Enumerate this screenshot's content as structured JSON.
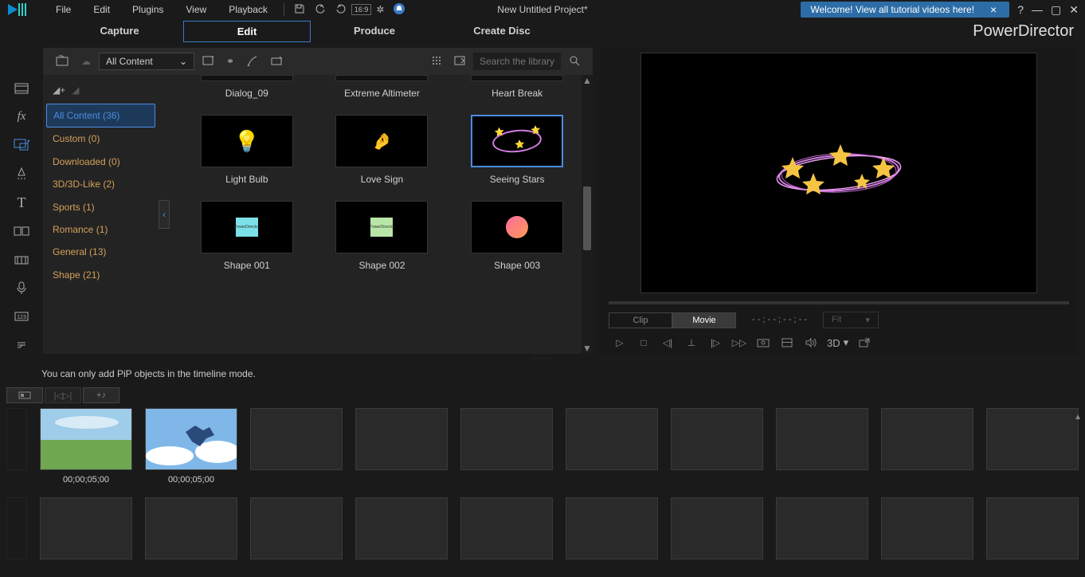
{
  "menubar": {
    "items": [
      "File",
      "Edit",
      "Plugins",
      "View",
      "Playback"
    ],
    "project_title": "New Untitled Project*",
    "aspect_label": "16:9",
    "notification": "Welcome! View all tutorial videos here!"
  },
  "modes": {
    "items": [
      "Capture",
      "Edit",
      "Produce",
      "Create Disc"
    ],
    "active": "Edit",
    "brand": "PowerDirector"
  },
  "library": {
    "filter_dropdown": "All Content",
    "search_placeholder": "Search the library",
    "categories": [
      {
        "label": "All Content (36)",
        "active": true
      },
      {
        "label": "Custom  (0)"
      },
      {
        "label": "Downloaded  (0)"
      },
      {
        "label": "3D/3D-Like  (2)"
      },
      {
        "label": "Sports  (1)"
      },
      {
        "label": "Romance  (1)"
      },
      {
        "label": "General  (13)"
      },
      {
        "label": "Shape  (21)"
      }
    ],
    "items": [
      {
        "label": "Dialog_09",
        "style": "stub"
      },
      {
        "label": "Extreme Altimeter",
        "style": "stub"
      },
      {
        "label": "Heart Break",
        "style": "stub"
      },
      {
        "label": "Light Bulb",
        "style": "bulb"
      },
      {
        "label": "Love Sign",
        "style": "hand"
      },
      {
        "label": "Seeing Stars",
        "style": "stars",
        "selected": true
      },
      {
        "label": "Shape 001",
        "style": "sq-cyan"
      },
      {
        "label": "Shape 002",
        "style": "sq-green"
      },
      {
        "label": "Shape 003",
        "style": "grad"
      }
    ]
  },
  "preview": {
    "toggle": [
      "Clip",
      "Movie"
    ],
    "toggle_active": "Movie",
    "timecode": "- - ; - - ; - - ; - -",
    "fit_label": "Fit",
    "three_d_label": "3D"
  },
  "info_message": "You can only add PiP objects in the timeline mode.",
  "storyboard": {
    "clips": [
      {
        "kind": "landscape",
        "time": "00;00;05;00"
      },
      {
        "kind": "skydive",
        "time": "00;00;05;00"
      }
    ],
    "empty_slots_row1": 8,
    "empty_slots_row2": 10
  }
}
